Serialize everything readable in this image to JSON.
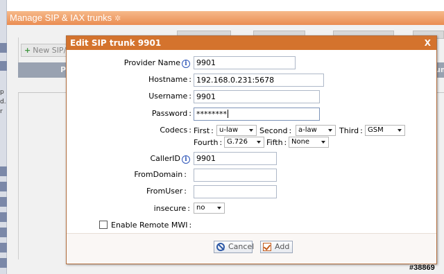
{
  "background": {
    "header_title": "Manage SIP & IAX trunks",
    "new_button": "New SIP/",
    "left_text": [
      "p",
      "d.",
      "r"
    ],
    "table_header_left": "P",
    "table_header_right": "um"
  },
  "dialog": {
    "title": "Edit SIP trunk 9901",
    "close": "X",
    "fields": {
      "provider_name": {
        "label": "Provider Name",
        "value": "9901"
      },
      "hostname": {
        "label": "Hostname",
        "value": "192.168.0.231:5678"
      },
      "username": {
        "label": "Username",
        "value": "9901"
      },
      "password": {
        "label": "Password",
        "value": "********"
      },
      "callerid": {
        "label": "CallerID",
        "value": "9901"
      },
      "fromdomain": {
        "label": "FromDomain",
        "value": ""
      },
      "fromuser": {
        "label": "FromUser",
        "value": ""
      },
      "insecure": {
        "label": "insecure",
        "value": "no"
      }
    },
    "codecs": {
      "label": "Codecs",
      "first_label": "First",
      "first": "u-law",
      "second_label": "Second",
      "second": "a-law",
      "third_label": "Third",
      "third": "GSM",
      "fourth_label": "Fourth",
      "fourth": "G.726",
      "fifth_label": "Fifth",
      "fifth": "None"
    },
    "remote_mwi": {
      "label": "Enable Remote MWI",
      "checked": false
    },
    "buttons": {
      "cancel": "Cancel",
      "add": "Add"
    }
  },
  "watermark": "#38869",
  "colors": {
    "accent": "#d4732d",
    "header": "#ea8d52",
    "table_head": "#9ea7b8"
  }
}
